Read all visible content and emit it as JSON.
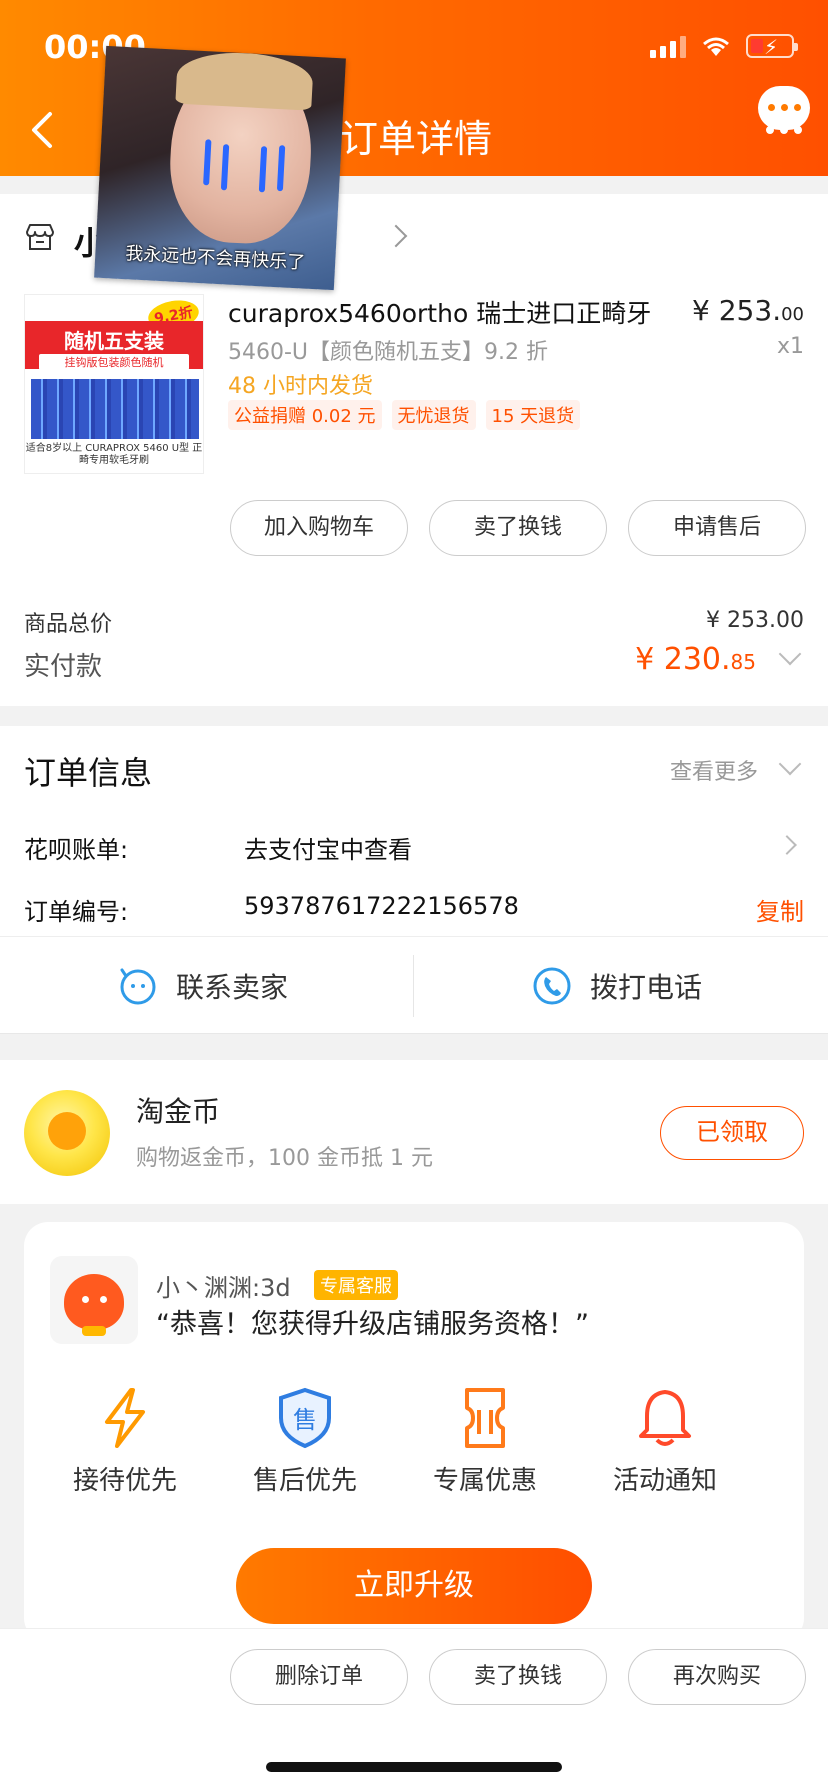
{
  "status_bar": {
    "time": "00:00"
  },
  "header": {
    "title": "订单详情"
  },
  "sticker": {
    "caption": "我永远也不会再快乐了"
  },
  "shop": {
    "name": "小"
  },
  "product": {
    "title": "curaprox5460ortho 瑞士进口正畸牙",
    "sku": "5460-U【颜色随机五支】9.2 折",
    "shipping": "48 小时内发货",
    "tags": [
      "公益捐赠 0.02 元",
      "无忧退货",
      "15 天退货"
    ],
    "price_main": "¥ 253.",
    "price_cents": "00",
    "qty": "x1",
    "image": {
      "banner": "随机五支装",
      "banner_sub": "挂钩版包装颜色随机",
      "badge": "9.2折",
      "foot": "适合8岁以上 CURAPROX 5460 U型 正畸专用软毛牙刷"
    }
  },
  "actions": [
    "加入购物车",
    "卖了换钱",
    "申请售后"
  ],
  "summary": {
    "goods_total_label": "商品总价",
    "goods_total": "¥ 253.00",
    "paid_label": "实付款",
    "paid_main": "¥ 230.",
    "paid_cents": "85"
  },
  "order_info": {
    "title": "订单信息",
    "more": "查看更多",
    "huabei_label": "花呗账单:",
    "huabei_value": "去支付宝中查看",
    "order_no_label": "订单编号:",
    "order_no": "593787617222156578",
    "copy": "复制",
    "contact_seller": "联系卖家",
    "call": "拨打电话"
  },
  "coins": {
    "title": "淘金币",
    "subtitle": "购物返金币，100 金币抵 1 元",
    "button": "已领取"
  },
  "service": {
    "name": "小丶渊渊:3d",
    "badge": "专属客服",
    "message": "“恭喜！您获得升级店铺服务资格！”",
    "features": [
      {
        "label": "接待优先",
        "icon": "lightning-icon"
      },
      {
        "label": "售后优先",
        "icon": "shield-icon"
      },
      {
        "label": "专属优惠",
        "icon": "ticket-icon"
      },
      {
        "label": "活动通知",
        "icon": "bell-icon"
      }
    ],
    "upgrade": "立即升级"
  },
  "bottom_actions": [
    "删除订单",
    "卖了换钱",
    "再次购买"
  ],
  "colors": {
    "accent": "#ff5000",
    "header_start": "#ff8a00",
    "header_end": "#ff5000"
  }
}
